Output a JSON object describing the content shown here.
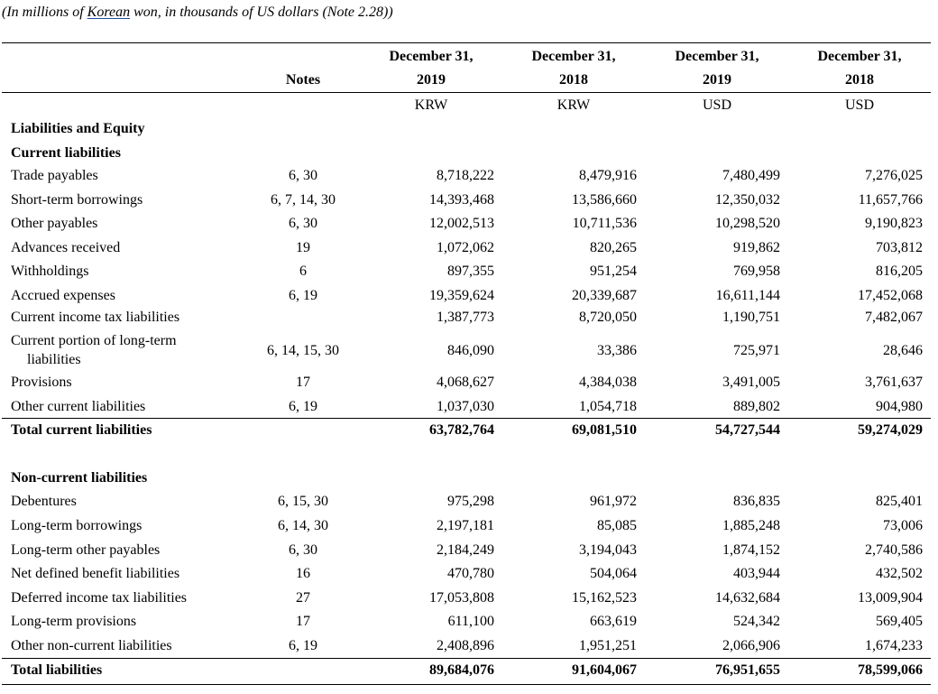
{
  "caption": {
    "pre": "(In millions of ",
    "link": "Korean",
    "post": " won, in thousands of US dollars (Note 2.28))"
  },
  "header": {
    "notes": "Notes",
    "columns": [
      {
        "line1": "December 31,",
        "line2": "2019",
        "currency": "KRW"
      },
      {
        "line1": "December 31,",
        "line2": "2018",
        "currency": "KRW"
      },
      {
        "line1": "December 31,",
        "line2": "2019",
        "currency": "USD"
      },
      {
        "line1": "December 31,",
        "line2": "2018",
        "currency": "USD"
      }
    ]
  },
  "sections": {
    "liabilities_and_equity": "Liabilities and Equity",
    "current": "Current liabilities",
    "non_current": "Non-current liabilities"
  },
  "current_rows": [
    {
      "label": "Trade payables",
      "notes": "6, 30",
      "values": [
        "8,718,222",
        "8,479,916",
        "7,480,499",
        "7,276,025"
      ]
    },
    {
      "label": "Short-term borrowings",
      "notes": "6, 7, 14, 30",
      "values": [
        "14,393,468",
        "13,586,660",
        "12,350,032",
        "11,657,766"
      ]
    },
    {
      "label": "Other payables",
      "notes": "6, 30",
      "values": [
        "12,002,513",
        "10,711,536",
        "10,298,520",
        "9,190,823"
      ]
    },
    {
      "label": "Advances received",
      "notes": "19",
      "values": [
        "1,072,062",
        "820,265",
        "919,862",
        "703,812"
      ]
    },
    {
      "label": "Withholdings",
      "notes": "6",
      "values": [
        "897,355",
        "951,254",
        "769,958",
        "816,205"
      ]
    },
    {
      "label": "Accrued expenses",
      "notes": "6, 19",
      "values": [
        "19,359,624",
        "20,339,687",
        "16,611,144",
        "17,452,068"
      ]
    },
    {
      "label": "Current income tax liabilities",
      "notes": "",
      "values": [
        "1,387,773",
        "8,720,050",
        "1,190,751",
        "7,482,067"
      ]
    },
    {
      "label_line1": "Current portion of long-term",
      "label_line2": "liabilities",
      "notes": "6, 14, 15, 30",
      "values": [
        "846,090",
        "33,386",
        "725,971",
        "28,646"
      ]
    },
    {
      "label": "Provisions",
      "notes": "17",
      "values": [
        "4,068,627",
        "4,384,038",
        "3,491,005",
        "3,761,637"
      ]
    },
    {
      "label": "Other current liabilities",
      "notes": "6, 19",
      "values": [
        "1,037,030",
        "1,054,718",
        "889,802",
        "904,980"
      ]
    }
  ],
  "current_total": {
    "label": "Total current liabilities",
    "values": [
      "63,782,764",
      "69,081,510",
      "54,727,544",
      "59,274,029"
    ]
  },
  "non_current_rows": [
    {
      "label": "Debentures",
      "notes": "6, 15, 30",
      "values": [
        "975,298",
        "961,972",
        "836,835",
        "825,401"
      ]
    },
    {
      "label": "Long-term borrowings",
      "notes": "6, 14, 30",
      "values": [
        "2,197,181",
        "85,085",
        "1,885,248",
        "73,006"
      ]
    },
    {
      "label": "Long-term other payables",
      "notes": "6, 30",
      "values": [
        "2,184,249",
        "3,194,043",
        "1,874,152",
        "2,740,586"
      ]
    },
    {
      "label": "Net defined benefit liabilities",
      "notes": "16",
      "values": [
        "470,780",
        "504,064",
        "403,944",
        "432,502"
      ]
    },
    {
      "label": "Deferred income tax liabilities",
      "notes": "27",
      "values": [
        "17,053,808",
        "15,162,523",
        "14,632,684",
        "13,009,904"
      ]
    },
    {
      "label": "Long-term provisions",
      "notes": "17",
      "values": [
        "611,100",
        "663,619",
        "524,342",
        "569,405"
      ]
    },
    {
      "label": "Other non-current liabilities",
      "notes": "6, 19",
      "values": [
        "2,408,896",
        "1,951,251",
        "2,066,906",
        "1,674,233"
      ]
    }
  ],
  "total_liabilities": {
    "label": "Total liabilities",
    "values": [
      "89,684,076",
      "91,604,067",
      "76,951,655",
      "78,599,066"
    ]
  }
}
